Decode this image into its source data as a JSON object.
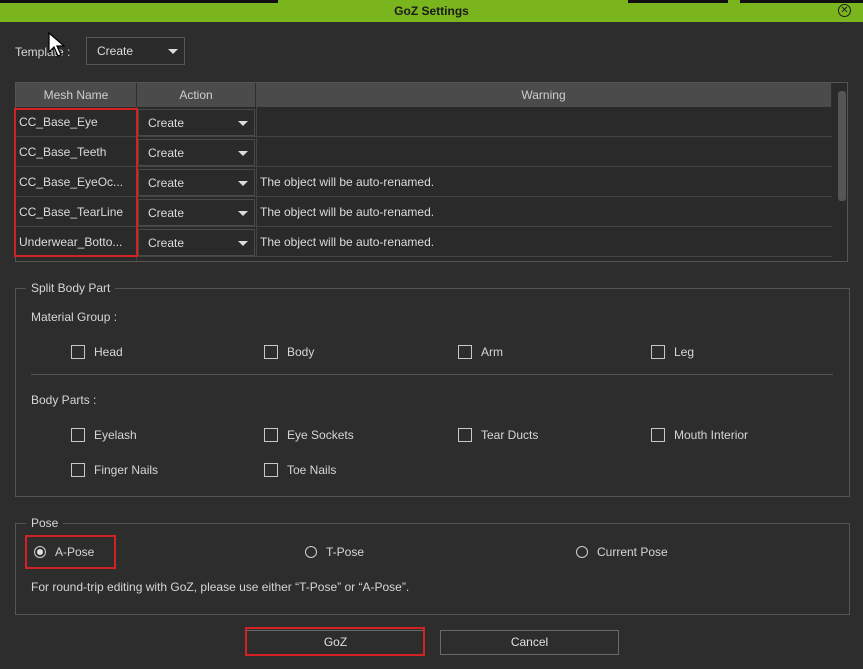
{
  "window": {
    "title": "GoZ Settings",
    "close_icon": "close-icon",
    "accent": "#7ab51d"
  },
  "template": {
    "label": "Template :",
    "value": "Create"
  },
  "table": {
    "headers": [
      "Mesh Name",
      "Action",
      "Warning"
    ],
    "rows": [
      {
        "name": "CC_Base_Eye",
        "action": "Create",
        "warning": ""
      },
      {
        "name": "CC_Base_Teeth",
        "action": "Create",
        "warning": ""
      },
      {
        "name": "CC_Base_EyeOc...",
        "action": "Create",
        "warning": "The object will be auto-renamed."
      },
      {
        "name": "CC_Base_TearLine",
        "action": "Create",
        "warning": "The object will be auto-renamed."
      },
      {
        "name": "Underwear_Botto...",
        "action": "Create",
        "warning": "The object will be auto-renamed."
      }
    ]
  },
  "split": {
    "legend": "Split Body Part",
    "material_label": "Material Group :",
    "materials": [
      "Head",
      "Body",
      "Arm",
      "Leg"
    ],
    "parts_label": "Body Parts :",
    "parts": [
      "Eyelash",
      "Eye Sockets",
      "Tear Ducts",
      "Mouth Interior",
      "Finger Nails",
      "Toe Nails"
    ]
  },
  "pose": {
    "legend": "Pose",
    "options": [
      "A-Pose",
      "T-Pose",
      "Current Pose"
    ],
    "selected": "A-Pose",
    "hint": "For round-trip editing with GoZ, please use either “T-Pose” or “A-Pose”."
  },
  "buttons": {
    "goz": "GoZ",
    "cancel": "Cancel"
  },
  "highlight_color": "#d42121"
}
